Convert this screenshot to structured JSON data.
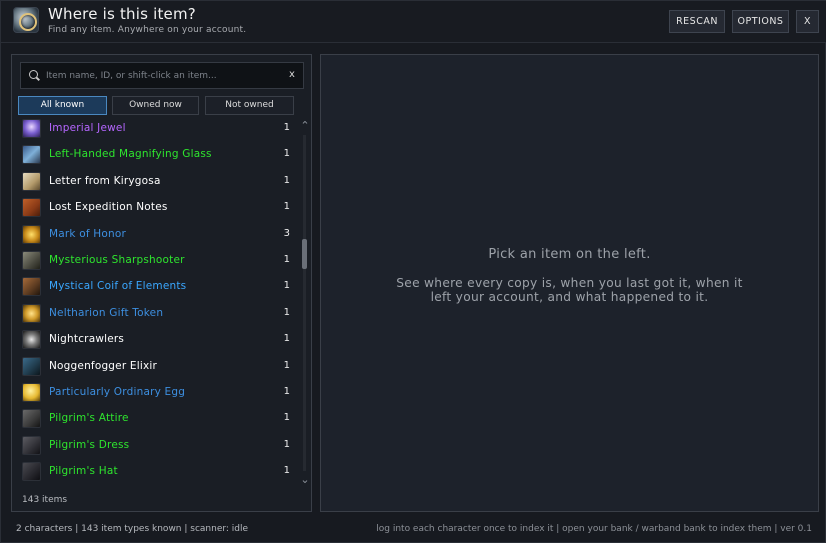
{
  "header": {
    "title": "Where is this item?",
    "subtitle": "Find any item. Anywhere on your account.",
    "buttons": {
      "rescan": "RESCAN",
      "options": "OPTIONS",
      "close": "X"
    }
  },
  "search": {
    "placeholder": "Item name, ID, or shift-click an item...",
    "clear": "x"
  },
  "filters": {
    "all_known": "All known",
    "owned_now": "Owned now",
    "not_owned": "Not owned",
    "active": "All known"
  },
  "items": [
    {
      "name": "Imperial Jewel",
      "count": "1",
      "color": "#b566ff",
      "icon": "jewel-icon"
    },
    {
      "name": "Left-Handed Magnifying Glass",
      "count": "1",
      "color": "#2ee52e",
      "icon": "magnifying-glass-icon"
    },
    {
      "name": "Letter from Kirygosa",
      "count": "1",
      "color": "#ffffff",
      "icon": "letter-icon"
    },
    {
      "name": "Lost Expedition Notes",
      "count": "1",
      "color": "#ffffff",
      "icon": "notes-icon"
    },
    {
      "name": "Mark of Honor",
      "count": "3",
      "color": "#3d8fe0",
      "icon": "mark-of-honor-icon"
    },
    {
      "name": "Mysterious Sharpshooter",
      "count": "1",
      "color": "#2ee52e",
      "icon": "sharpshooter-icon"
    },
    {
      "name": "Mystical Coif of Elements",
      "count": "1",
      "color": "#3aa7ff",
      "icon": "coif-icon"
    },
    {
      "name": "Neltharion Gift Token",
      "count": "1",
      "color": "#3d8fe0",
      "icon": "gift-token-icon"
    },
    {
      "name": "Nightcrawlers",
      "count": "1",
      "color": "#ffffff",
      "icon": "nightcrawlers-icon"
    },
    {
      "name": "Noggenfogger Elixir",
      "count": "1",
      "color": "#ffffff",
      "icon": "elixir-icon"
    },
    {
      "name": "Particularly Ordinary Egg",
      "count": "1",
      "color": "#3d8fe0",
      "icon": "egg-icon"
    },
    {
      "name": "Pilgrim's Attire",
      "count": "1",
      "color": "#2ee52e",
      "icon": "attire-icon"
    },
    {
      "name": "Pilgrim's Dress",
      "count": "1",
      "color": "#2ee52e",
      "icon": "dress-icon"
    },
    {
      "name": "Pilgrim's Hat",
      "count": "1",
      "color": "#2ee52e",
      "icon": "hat-icon"
    }
  ],
  "list_count": "143 items",
  "detail": {
    "prompt": "Pick an item on the left.",
    "explanation": "See where every copy is, when you last got it, when it left your account, and what happened to it."
  },
  "footer": {
    "status": "2 characters  |  143 item types known  |  scanner: idle",
    "hints": "log into each character once to index it  |  open your bank / warband bank to index them  |  ver 0.1"
  }
}
